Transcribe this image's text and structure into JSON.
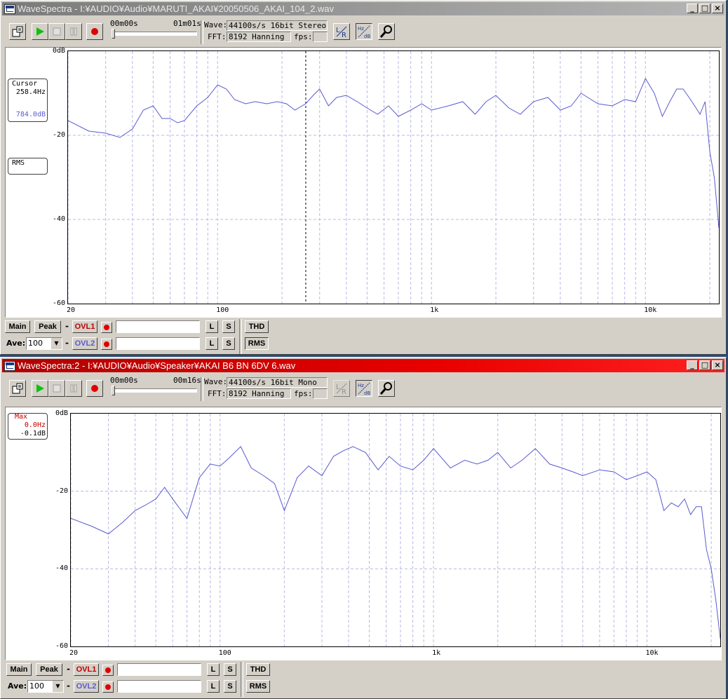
{
  "colors": {
    "trace": "#5a5ad0",
    "grid": "#b8b8e8",
    "overlay_red": "#c00000"
  },
  "windows": [
    {
      "id": "w1",
      "title": "WaveSpectra - I:¥AUDIO¥Audio¥MARUTI_AKAI¥20050506_AKAI_104_2.wav",
      "active": false,
      "time_start": "00m00s",
      "time_end": "01m01s",
      "position": 0.0,
      "wave_label": "Wave:",
      "wave_value": "44100s/s 16bit Stereo",
      "fft_label": "FFT:",
      "fft_value": "8192 Hanning",
      "fps_label": "fps:",
      "fps_value": "",
      "readout1": {
        "title": "Cursor",
        "line1": "258.4Hz",
        "line2": "784.0dB"
      },
      "readout2": {
        "title": "RMS"
      },
      "cursor_hz": 258.4,
      "y_ticks": [
        "0dB",
        "-20",
        "-40",
        "-60"
      ],
      "x_ticks": [
        "20",
        "100",
        "1k",
        "10k"
      ],
      "bottom": {
        "main": "Main",
        "peak": "Peak",
        "ovl1": "OVL1",
        "ovl2": "OVL2",
        "ave_label": "Ave:",
        "ave_value": "100",
        "l": "L",
        "s": "S",
        "thd": "THD",
        "rms": "RMS"
      }
    },
    {
      "id": "w2",
      "title": "WaveSpectra:2 - I:¥AUDIO¥Audio¥Speaker¥AKAI B6 BN 6DV 6.wav",
      "active": true,
      "time_start": "00m00s",
      "time_end": "00m16s",
      "position": 0.0,
      "wave_label": "Wave:",
      "wave_value": "44100s/s 16bit Mono",
      "fft_label": "FFT:",
      "fft_value": "8192 Hanning",
      "fps_label": "fps:",
      "fps_value": "",
      "readout1": {
        "title": "Max",
        "line1": "0.0Hz",
        "line2": "-0.1dB"
      },
      "y_ticks": [
        "0dB",
        "-20",
        "-40",
        "-60"
      ],
      "x_ticks": [
        "20",
        "100",
        "1k",
        "10k"
      ],
      "bottom": {
        "main": "Main",
        "peak": "Peak",
        "ovl1": "OVL1",
        "ovl2": "OVL2",
        "ave_label": "Ave:",
        "ave_value": "100",
        "l": "L",
        "s": "S",
        "thd": "THD",
        "rms": "RMS"
      }
    }
  ],
  "chart_data": [
    {
      "type": "line",
      "x_scale": "log",
      "xlim": [
        20,
        22050
      ],
      "ylim": [
        -60,
        0
      ],
      "grid": true,
      "series": [
        {
          "x": [
            20,
            25,
            30,
            35,
            40,
            45,
            50,
            55,
            60,
            65,
            70,
            80,
            90,
            100,
            110,
            120,
            135,
            150,
            170,
            190,
            210,
            230,
            258,
            280,
            300,
            330,
            360,
            400,
            450,
            500,
            560,
            630,
            700,
            800,
            900,
            1000,
            1200,
            1400,
            1600,
            1800,
            2000,
            2300,
            2600,
            3000,
            3500,
            4000,
            4500,
            5000,
            6000,
            7000,
            8000,
            9000,
            10000,
            11000,
            12000,
            13000,
            14000,
            15000,
            16000,
            17000,
            18000,
            19000,
            20000,
            21000,
            22050
          ],
          "y": [
            -16.5,
            -19,
            -19.5,
            -20.5,
            -18.5,
            -14,
            -13,
            -16,
            -16,
            -17,
            -16.5,
            -13,
            -11,
            -8,
            -9,
            -11.5,
            -12.5,
            -12,
            -12.5,
            -12,
            -12.5,
            -14,
            -12.5,
            -10.5,
            -9,
            -13,
            -11,
            -10.5,
            -12,
            -13.5,
            -15,
            -13,
            -15.5,
            -14,
            -12.5,
            -14,
            -13,
            -12,
            -15,
            -12,
            -10.5,
            -13.5,
            -15,
            -12,
            -11,
            -14,
            -13,
            -10,
            -12.5,
            -13,
            -11.5,
            -12,
            -6.5,
            -10,
            -15.5,
            -12,
            -9,
            -9,
            -11,
            -13,
            -15,
            -12,
            -24,
            -30,
            -42
          ]
        }
      ]
    },
    {
      "type": "line",
      "x_scale": "log",
      "xlim": [
        20,
        22050
      ],
      "ylim": [
        -60,
        0
      ],
      "grid": true,
      "series": [
        {
          "x": [
            20,
            25,
            30,
            35,
            40,
            45,
            50,
            55,
            60,
            70,
            80,
            90,
            100,
            110,
            125,
            140,
            160,
            180,
            200,
            230,
            260,
            300,
            340,
            380,
            420,
            480,
            550,
            620,
            700,
            800,
            900,
            1000,
            1200,
            1400,
            1600,
            1800,
            2000,
            2300,
            2600,
            3000,
            3500,
            4000,
            4500,
            5000,
            6000,
            7000,
            8000,
            9000,
            10000,
            11000,
            12000,
            13000,
            14000,
            15000,
            16000,
            17000,
            18000,
            19000,
            20000,
            21000,
            22050
          ],
          "y": [
            -27,
            -29,
            -31,
            -28,
            -25,
            -23.5,
            -22,
            -19,
            -22,
            -27,
            -16.5,
            -13,
            -13.5,
            -11.5,
            -8.5,
            -14,
            -16,
            -18,
            -25,
            -16.5,
            -13.5,
            -16,
            -11,
            -9.5,
            -8.5,
            -10,
            -14.5,
            -11,
            -13.5,
            -14.5,
            -12,
            -9,
            -14,
            -12,
            -13,
            -12,
            -10,
            -14,
            -12,
            -9,
            -13,
            -14,
            -15,
            -16,
            -14.5,
            -15,
            -17,
            -16,
            -15,
            -17,
            -25,
            -23,
            -24,
            -22,
            -26,
            -24,
            -24,
            -35,
            -40,
            -48,
            -58
          ]
        }
      ]
    }
  ]
}
